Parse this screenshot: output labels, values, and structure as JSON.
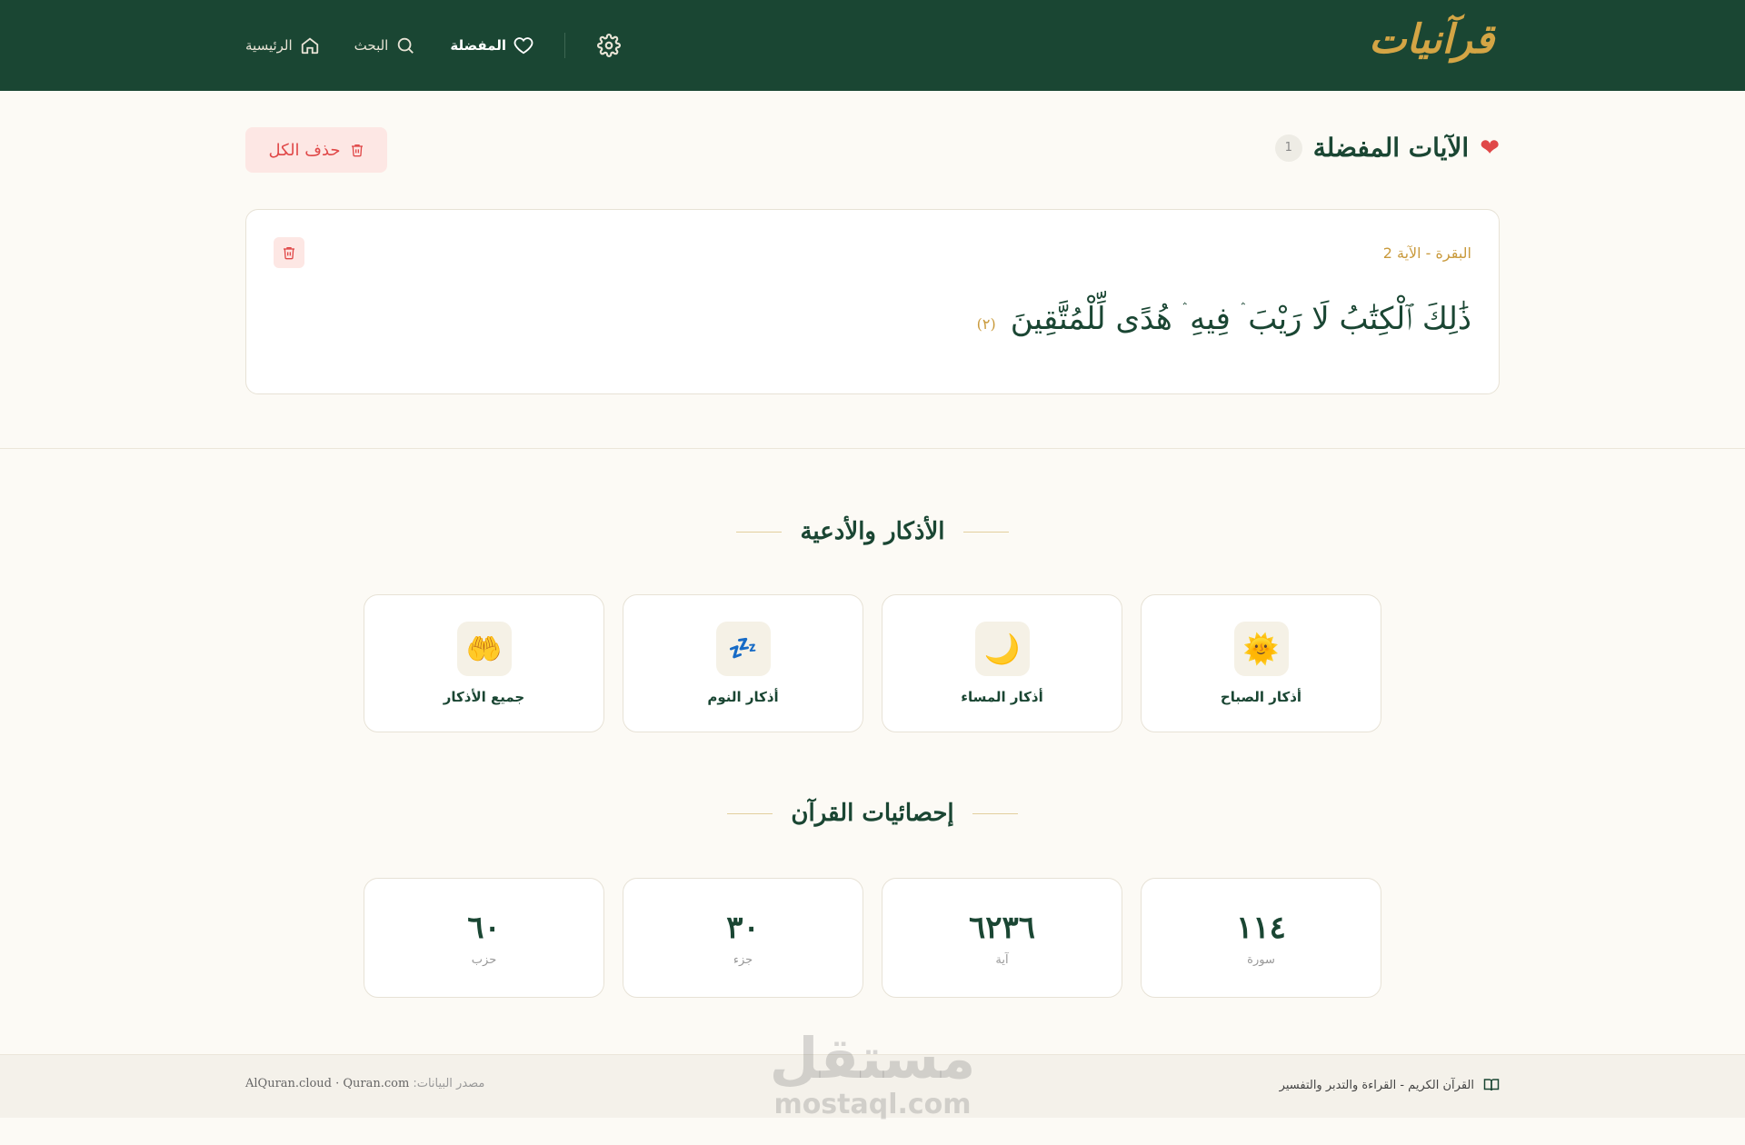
{
  "header": {
    "logo": "قرآنيات",
    "nav": [
      {
        "label": "الرئيسية",
        "icon": "home-icon"
      },
      {
        "label": "البحث",
        "icon": "search-icon"
      },
      {
        "label": "المفضلة",
        "icon": "heart-icon"
      }
    ],
    "settings_icon": "gear-icon"
  },
  "favorites": {
    "title": "الآيات المفضلة",
    "count": "1",
    "delete_all_label": "حذف الكل",
    "verses": [
      {
        "reference": "البقرة - الآية 2",
        "text": "ذَٰلِكَ ٱلْكِتَٰبُ لَا رَيْبَ ۛ فِيهِ ۛ هُدًى لِّلْمُتَّقِينَ",
        "number": "(٢)"
      }
    ]
  },
  "adhkar": {
    "title": "الأذكار والأدعية",
    "items": [
      {
        "label": "أذكار الصباح",
        "icon": "sun-icon"
      },
      {
        "label": "أذكار المساء",
        "icon": "moon-icon"
      },
      {
        "label": "أذكار النوم",
        "icon": "sleep-icon"
      },
      {
        "label": "جميع الأذكار",
        "icon": "praying-hands-icon"
      }
    ]
  },
  "stats": {
    "title": "إحصائيات القرآن",
    "items": [
      {
        "value": "١١٤",
        "label": "سورة"
      },
      {
        "value": "٦٢٣٦",
        "label": "آية"
      },
      {
        "value": "٣٠",
        "label": "جزء"
      },
      {
        "value": "٦٠",
        "label": "حزب"
      }
    ]
  },
  "footer": {
    "tagline": "القرآن الكريم - القراءة والتدبر والتفسير",
    "source_label": "مصدر البيانات:",
    "sources": "AlQuran.cloud · Quran.com"
  },
  "watermark": {
    "arabic": "مستقل",
    "latin": "mostaql.com"
  },
  "colors": {
    "primary": "#1a4633",
    "gold": "#d4a545",
    "danger": "#e04848",
    "background": "#fcfaf5"
  }
}
